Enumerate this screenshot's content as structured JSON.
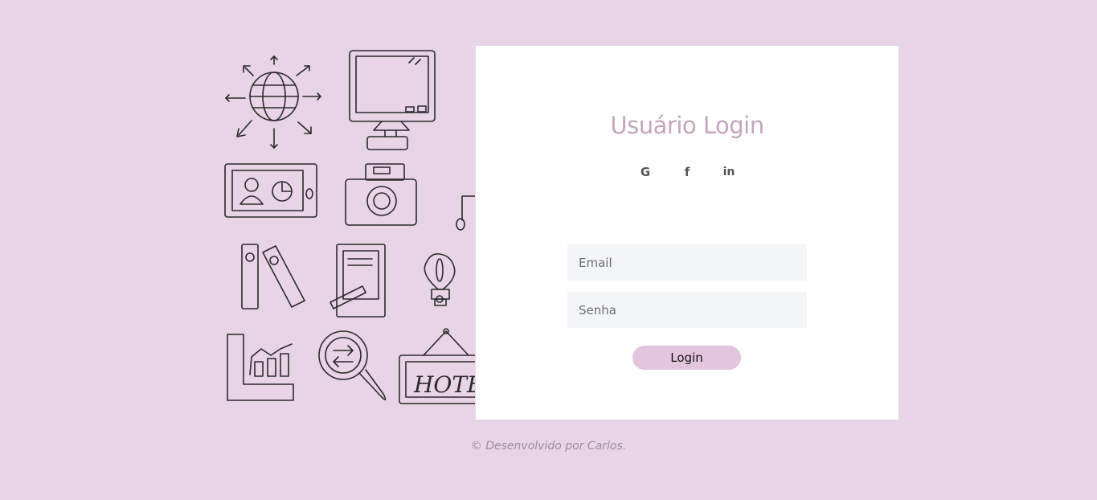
{
  "login": {
    "title": "Usuário Login",
    "socials": [
      {
        "icon": "google-icon",
        "glyph": "G"
      },
      {
        "icon": "facebook-icon",
        "glyph": "f"
      },
      {
        "icon": "linkedin-icon",
        "glyph": "in"
      }
    ],
    "email_placeholder": "Email",
    "email_value": "",
    "password_placeholder": "Senha",
    "password_value": "",
    "button_label": "Login"
  },
  "footer": {
    "text": "© Desenvolvido por Carlos."
  },
  "illustration": {
    "hotel_sign": "HOTEL"
  },
  "colors": {
    "background": "#e8d4e6",
    "title": "#c4a6bc",
    "button": "#e3c6dd",
    "input_bg": "#f4f5f7"
  }
}
